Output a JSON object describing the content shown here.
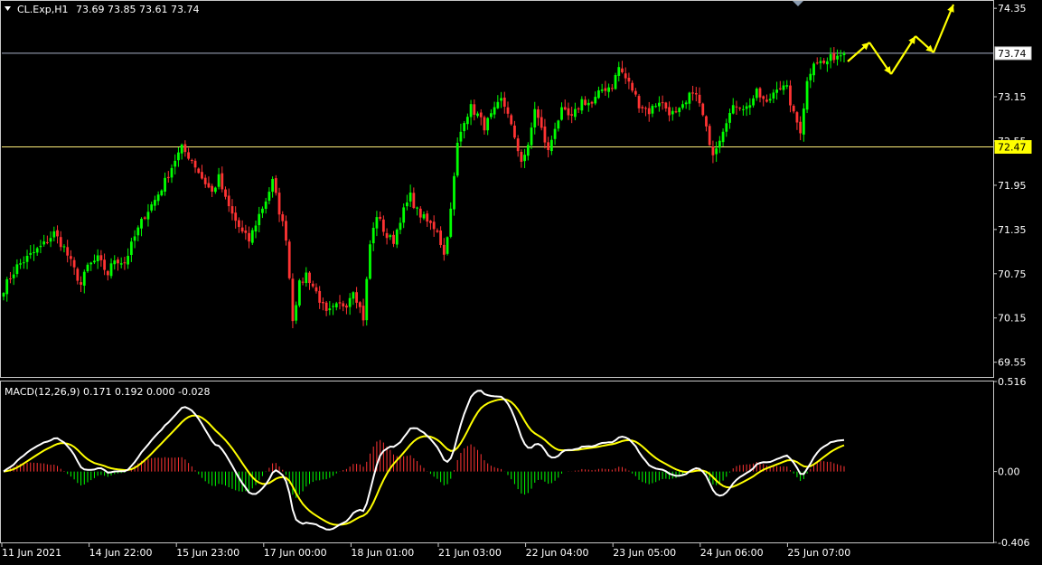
{
  "chart_data": [
    {
      "type": "candlestick",
      "symbol_header": "CL.Exp,H1",
      "ohlc_header": "73.69 73.85 73.61 73.74",
      "y_ticks": [
        "74.35",
        "73.15",
        "72.55",
        "71.95",
        "71.35",
        "70.75",
        "70.15",
        "69.55"
      ],
      "ylim": [
        69.35,
        74.45
      ],
      "x_ticks": [
        "11 Jun 2021",
        "14 Jun 22:00",
        "15 Jun 23:00",
        "17 Jun 00:00",
        "18 Jun 01:00",
        "21 Jun 03:00",
        "22 Jun 04:00",
        "23 Jun 05:00",
        "24 Jun 06:00",
        "25 Jun 07:00"
      ],
      "hlines": [
        {
          "value": 73.74,
          "label": "73.74",
          "color": "#a9b3c8"
        },
        {
          "value": 72.47,
          "label": "72.47",
          "color": "#ffef7a"
        }
      ],
      "bull_color": "#00ff00",
      "bear_color": "#ff3333",
      "close_path_keys": [
        [
          0,
          70.55
        ],
        [
          4,
          70.85
        ],
        [
          8,
          71.0
        ],
        [
          12,
          71.15
        ],
        [
          15,
          71.3
        ],
        [
          18,
          71.1
        ],
        [
          21,
          70.8
        ],
        [
          23,
          70.6
        ],
        [
          25,
          70.85
        ],
        [
          28,
          70.95
        ],
        [
          31,
          70.75
        ],
        [
          33,
          70.95
        ],
        [
          36,
          70.9
        ],
        [
          39,
          71.25
        ],
        [
          42,
          71.55
        ],
        [
          45,
          71.75
        ],
        [
          48,
          72.0
        ],
        [
          51,
          72.3
        ],
        [
          53,
          72.45
        ],
        [
          56,
          72.3
        ],
        [
          59,
          72.05
        ],
        [
          62,
          71.85
        ],
        [
          64,
          72.05
        ],
        [
          66,
          71.75
        ],
        [
          68,
          71.55
        ],
        [
          71,
          71.3
        ],
        [
          73,
          71.2
        ],
        [
          76,
          71.55
        ],
        [
          78,
          71.75
        ],
        [
          80,
          72.0
        ],
        [
          82,
          71.6
        ],
        [
          84,
          71.25
        ],
        [
          86,
          70.15
        ],
        [
          88,
          70.6
        ],
        [
          90,
          70.75
        ],
        [
          93,
          70.5
        ],
        [
          96,
          70.2
        ],
        [
          99,
          70.3
        ],
        [
          102,
          70.35
        ],
        [
          104,
          70.55
        ],
        [
          107,
          70.15
        ],
        [
          109,
          71.15
        ],
        [
          111,
          71.55
        ],
        [
          114,
          71.25
        ],
        [
          116,
          71.2
        ],
        [
          118,
          71.5
        ],
        [
          121,
          71.8
        ],
        [
          123,
          71.6
        ],
        [
          126,
          71.45
        ],
        [
          129,
          71.35
        ],
        [
          131,
          71.0
        ],
        [
          133,
          71.6
        ],
        [
          135,
          72.5
        ],
        [
          137,
          72.85
        ],
        [
          139,
          73.0
        ],
        [
          141,
          72.9
        ],
        [
          143,
          72.75
        ],
        [
          146,
          72.95
        ],
        [
          148,
          73.1
        ],
        [
          150,
          72.95
        ],
        [
          152,
          72.55
        ],
        [
          154,
          72.3
        ],
        [
          156,
          72.45
        ],
        [
          158,
          73.0
        ],
        [
          160,
          72.7
        ],
        [
          162,
          72.4
        ],
        [
          164,
          72.75
        ],
        [
          166,
          72.95
        ],
        [
          169,
          72.85
        ],
        [
          172,
          73.1
        ],
        [
          175,
          73.05
        ],
        [
          178,
          73.25
        ],
        [
          181,
          73.3
        ],
        [
          183,
          73.55
        ],
        [
          185,
          73.4
        ],
        [
          187,
          73.25
        ],
        [
          189,
          73.05
        ],
        [
          192,
          72.95
        ],
        [
          195,
          73.1
        ],
        [
          198,
          72.95
        ],
        [
          200,
          72.9
        ],
        [
          203,
          73.05
        ],
        [
          205,
          73.25
        ],
        [
          207,
          73.05
        ],
        [
          209,
          72.7
        ],
        [
          211,
          72.4
        ],
        [
          213,
          72.6
        ],
        [
          215,
          72.85
        ],
        [
          218,
          73.05
        ],
        [
          221,
          73.0
        ],
        [
          224,
          73.2
        ],
        [
          227,
          73.05
        ],
        [
          230,
          73.3
        ],
        [
          233,
          73.25
        ],
        [
          235,
          72.9
        ],
        [
          237,
          72.7
        ],
        [
          239,
          73.35
        ],
        [
          241,
          73.65
        ],
        [
          244,
          73.6
        ],
        [
          247,
          73.7
        ],
        [
          250,
          73.75
        ]
      ],
      "forecast_arrows": [
        [
          [
            938,
            68
          ],
          [
            962,
            47
          ]
        ],
        [
          [
            962,
            47
          ],
          [
            986,
            82
          ]
        ],
        [
          [
            986,
            82
          ],
          [
            1013,
            40
          ]
        ],
        [
          [
            1013,
            40
          ],
          [
            1033,
            58
          ]
        ],
        [
          [
            1033,
            58
          ],
          [
            1055,
            5
          ]
        ]
      ],
      "forecast_color": "#ffff00"
    },
    {
      "type": "macd",
      "header": "MACD(12,26,9) 0.171 0.192 0.000 -0.028",
      "y_ticks": [
        "0.516",
        "0.00",
        "-0.406"
      ],
      "ylim": [
        -0.406,
        0.516
      ],
      "macd_line_color": "#ffffff",
      "signal_line_color": "#ffff00",
      "histogram_up_color": "#ff3333",
      "histogram_down_color": "#00ff00"
    }
  ]
}
